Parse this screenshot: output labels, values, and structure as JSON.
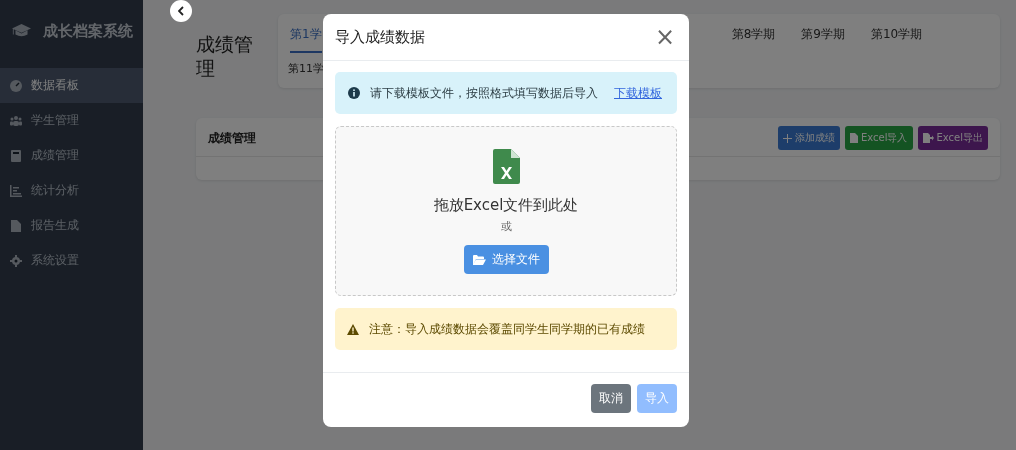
{
  "sidebar": {
    "brand": "成长档案系统",
    "items": [
      {
        "label": "数据看板",
        "selected": true
      },
      {
        "label": "学生管理",
        "selected": false
      },
      {
        "label": "成绩管理",
        "selected": false
      },
      {
        "label": "统计分析",
        "selected": false
      },
      {
        "label": "报告生成",
        "selected": false
      },
      {
        "label": "系统设置",
        "selected": false
      }
    ]
  },
  "page_title": "成绩管理",
  "term_tabs": [
    [
      {
        "label": "第1学",
        "selected": true
      },
      {
        "label": "第8学期",
        "selected": false
      },
      {
        "label": "第9学期",
        "selected": false
      },
      {
        "label": "第10学期",
        "selected": false
      }
    ],
    [
      {
        "label": "第11学",
        "selected": false
      }
    ]
  ],
  "card": {
    "title": "成绩管理",
    "buttons": [
      {
        "label": "添加成绩",
        "kind": "add"
      },
      {
        "label": "Excel导入",
        "kind": "import"
      },
      {
        "label": "Excel导出",
        "kind": "export"
      }
    ]
  },
  "dialog": {
    "title": "导入成绩数据",
    "close": "×",
    "info": {
      "text": "请下载模板文件，按照格式填写数据后导入",
      "link": "下载模板"
    },
    "dropzone": {
      "title": "拖放Excel文件到此处",
      "or": "或",
      "button": "选择文件"
    },
    "warning": "注意：导入成绩数据会覆盖同学生同学期的已有成绩",
    "buttons": [
      {
        "label": "取消",
        "kind": "secondary",
        "disabled": false
      },
      {
        "label": "导入",
        "kind": "primary",
        "disabled": true
      }
    ]
  }
}
